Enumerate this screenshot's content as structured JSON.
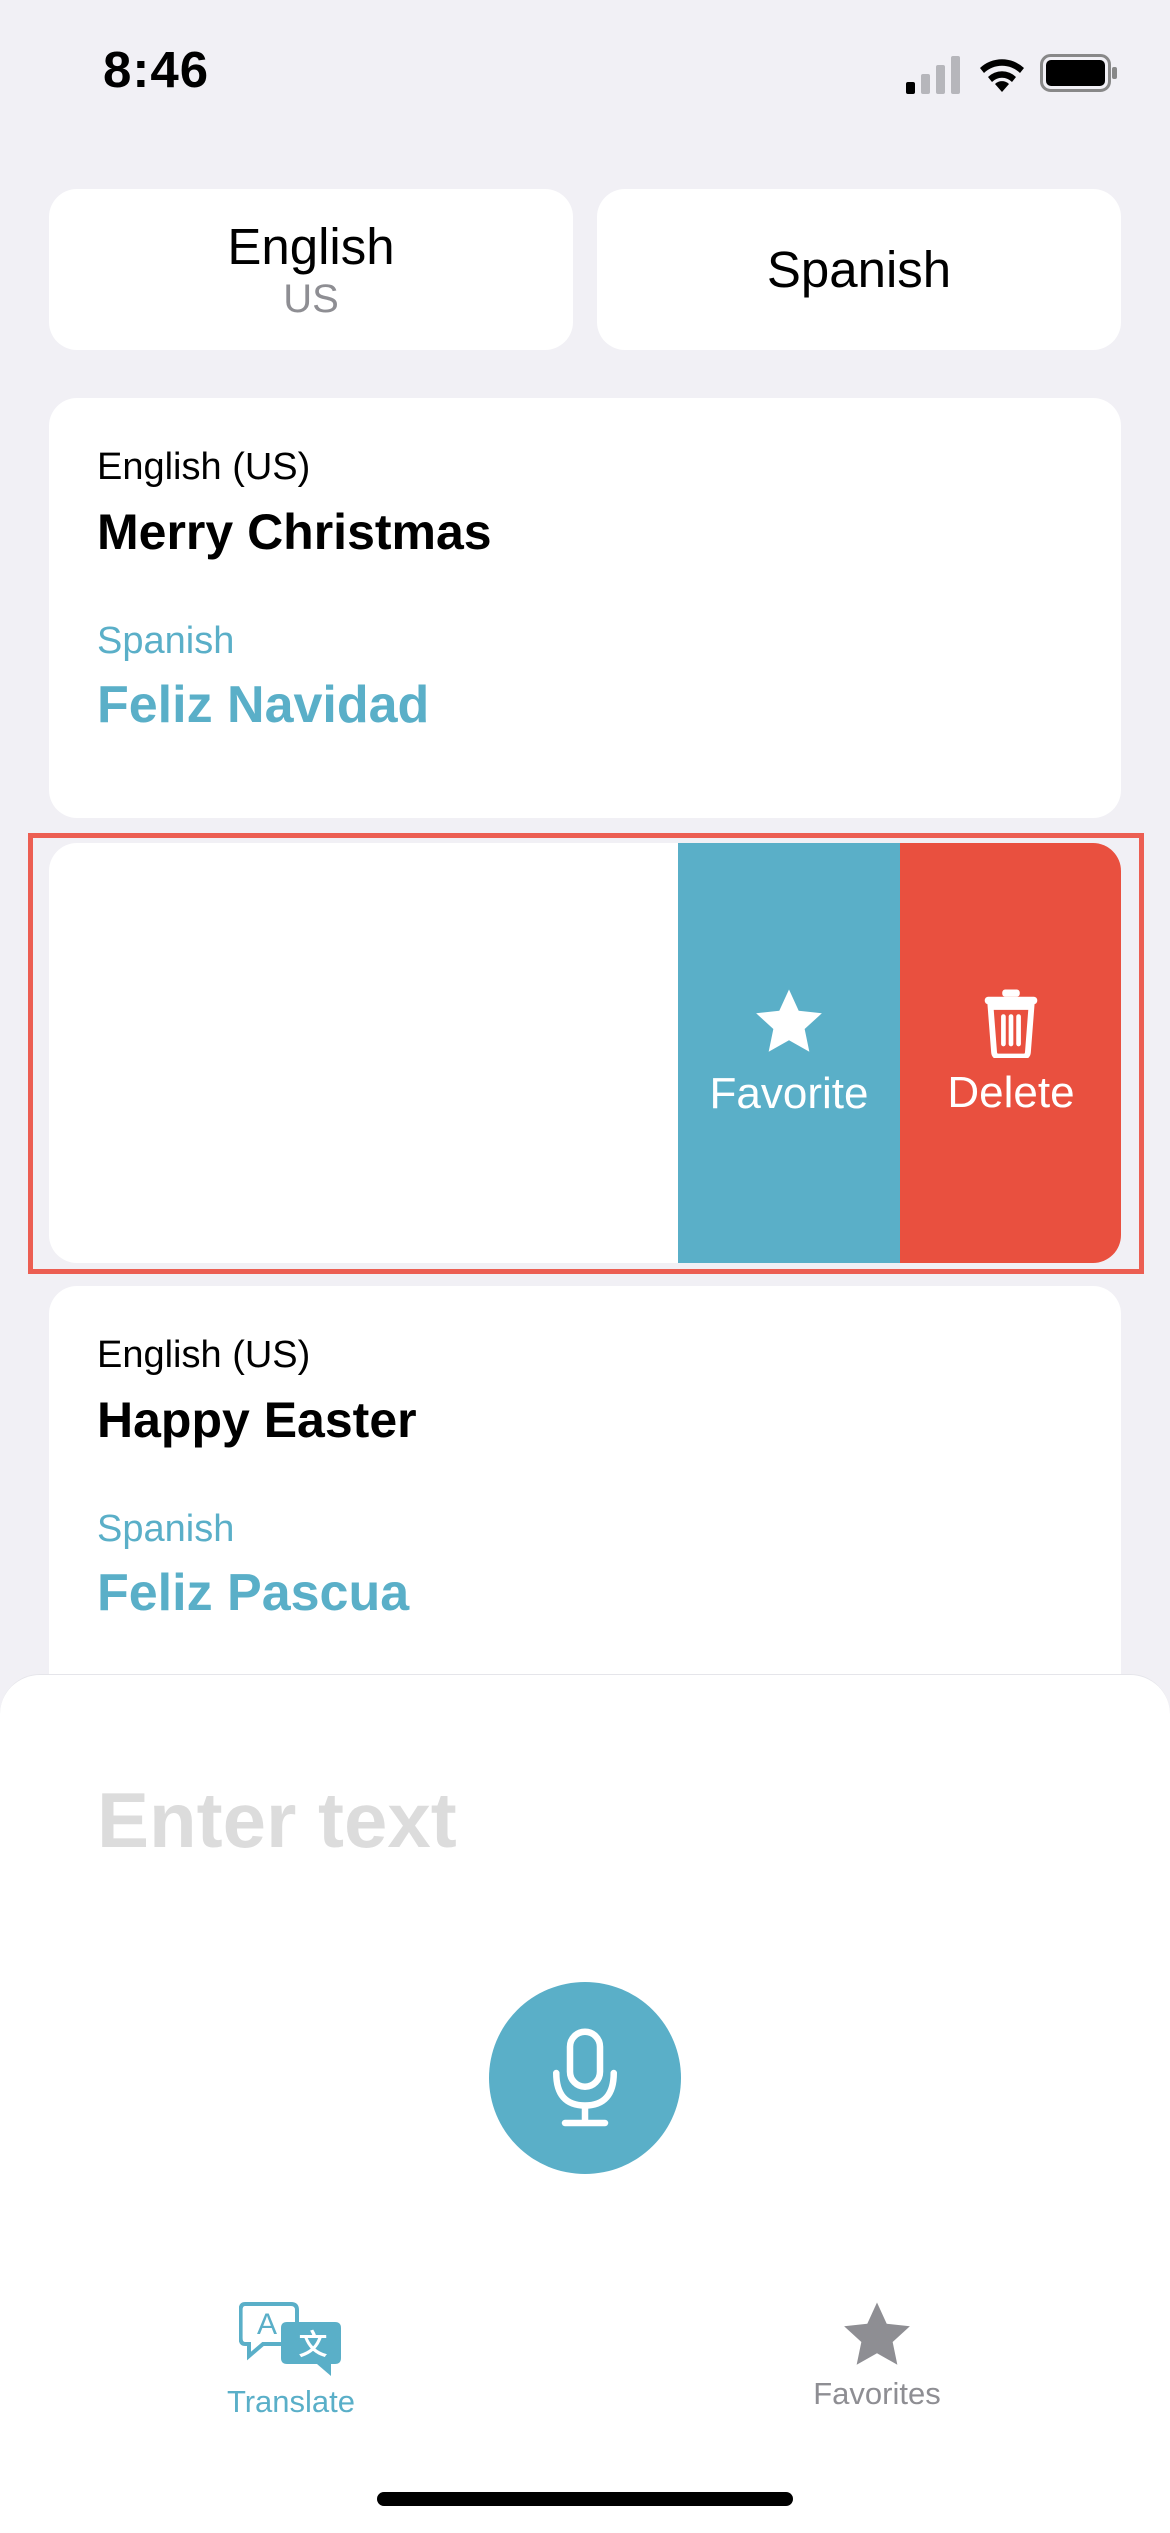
{
  "status_bar": {
    "time": "8:46"
  },
  "language_selector": {
    "source_language": "English",
    "source_region": "US",
    "target_language": "Spanish"
  },
  "translations": [
    {
      "source_language": "English (US)",
      "source_text": "Merry Christmas",
      "target_language": "Spanish",
      "target_text": "Feliz Navidad"
    },
    {
      "source_language": "English (US)",
      "source_text": "Happy Easter",
      "target_language": "Spanish",
      "target_text": "Feliz Pascua"
    }
  ],
  "swipe_actions": {
    "favorite_label": "Favorite",
    "delete_label": "Delete"
  },
  "input": {
    "placeholder": "Enter text"
  },
  "tab_bar": {
    "translate_label": "Translate",
    "favorites_label": "Favorites"
  },
  "colors": {
    "accent": "#5aafc8",
    "delete": "#e9503f",
    "highlight_frame": "#ec5e52",
    "background": "#f1f0f5"
  },
  "icons": {
    "favorite": "star-icon",
    "delete": "trash-icon",
    "mic": "microphone-icon",
    "translate_tab": "translate-icon",
    "favorites_tab": "star-icon"
  }
}
